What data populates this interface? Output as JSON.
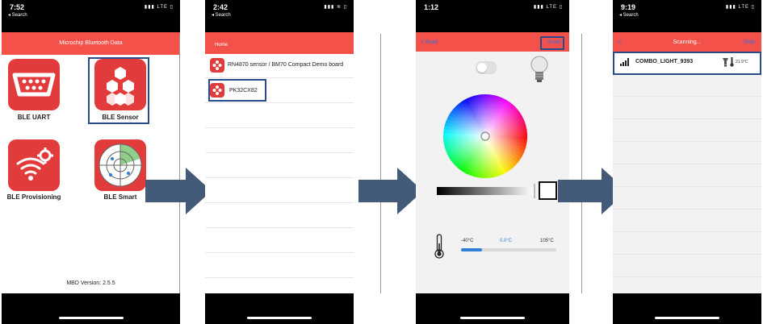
{
  "screens": [
    {
      "status": {
        "time": "7:52",
        "back": "◂ Search",
        "icons": "▮▮▮ LTE ▯"
      },
      "title": "Microchip Bluetooth Data",
      "apps": [
        {
          "label": "BLE UART",
          "icon": "serial-port-icon"
        },
        {
          "label": "BLE Sensor",
          "icon": "hexagon-cluster-icon"
        },
        {
          "label": "BLE Provisioning",
          "icon": "wifi-gear-icon"
        },
        {
          "label": "BLE Smart",
          "icon": "radar-icon"
        }
      ],
      "version": "MBD Version: 2.5.5"
    },
    {
      "status": {
        "time": "2:42",
        "back": "◂ Search",
        "icons": "▮▮▮ ≋ ▯"
      },
      "nav_title": "Home",
      "devices": [
        {
          "label": "RN4870 sensor / BM70 Compact Demo board"
        },
        {
          "label": "PK32CX82"
        }
      ]
    },
    {
      "status": {
        "time": "1:12",
        "back": "",
        "icons": "▮▮▮ LTE ▯"
      },
      "back_label": "< Back",
      "scale_label": "Scale",
      "temps": {
        "min": "-40°C",
        "current": "0.0°C",
        "max": "105°C",
        "level": 0.22
      }
    },
    {
      "status": {
        "time": "9:19",
        "back": "◂ Search",
        "icons": "▮▮▮ LTE ▯"
      },
      "back_icon": "<",
      "title": "Scanning...",
      "stop_label": "Stop",
      "device": {
        "name": "COMBO_LIGHT_9393",
        "temp": "21.9°C"
      }
    }
  ],
  "colors": {
    "accent": "#f4514a",
    "tile": "#e23b3b",
    "highlight": "#2b4c8c",
    "arrow": "#435a78",
    "blue": "#2f7fd8"
  }
}
